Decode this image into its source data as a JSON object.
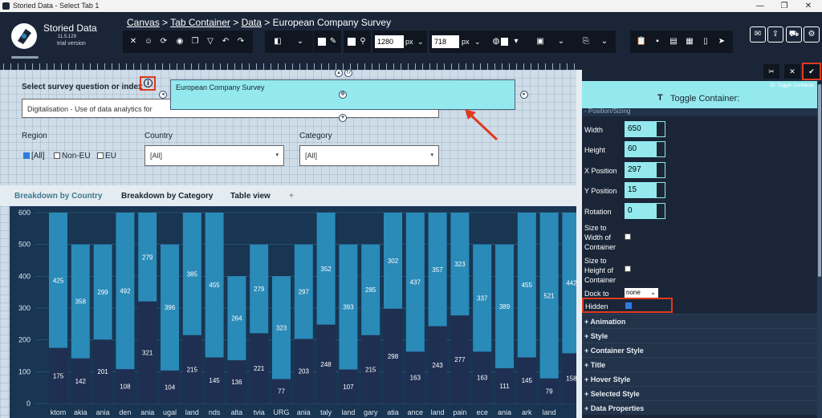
{
  "window": {
    "title": "Storied Data - Select Tab 1",
    "controls": [
      "—",
      "❐",
      "✕"
    ]
  },
  "app": {
    "name": "Storied Data",
    "version": "11.5.129",
    "edition": "trial version"
  },
  "breadcrumb": {
    "items": [
      "Canvas",
      "Tab Container",
      "Data"
    ],
    "sep": ">",
    "current": "European Company Survey"
  },
  "toolbar": {
    "width_value": "1280",
    "height_value": "718",
    "unit": "px"
  },
  "canvas": {
    "question_label": "Select survey question or index",
    "question_value": "Digitalisation - Use of data analytics for",
    "overlay_title": "European Company Survey",
    "region_label": "Region",
    "country_label": "Country",
    "category_label": "Category",
    "regions": [
      {
        "label": "[All]",
        "checked": true
      },
      {
        "label": "Non-EU",
        "checked": false
      },
      {
        "label": "EU",
        "checked": false
      }
    ],
    "country_value": "[All]",
    "category_value": "[All]",
    "tabs": [
      "Breakdown by Country",
      "Breakdown by Category",
      "Table view"
    ],
    "tab_add": "+"
  },
  "chart_data": {
    "type": "bar",
    "stacked": true,
    "ylim": [
      0,
      600
    ],
    "yticks": [
      "0",
      "100",
      "200",
      "300",
      "400",
      "500",
      "600"
    ],
    "xlabels": [
      "ktom",
      "akia",
      "ania",
      "den",
      "ania",
      "ugal",
      "land",
      "nds",
      "alta",
      "tvia",
      "URG",
      "ania",
      "taly",
      "land",
      "gary",
      "atia",
      "ance",
      "land",
      "pain",
      "ece",
      "ania",
      "ark",
      "land",
      ""
    ],
    "series": [
      {
        "values": [
          175,
          142,
          201,
          108,
          321,
          104,
          215,
          145,
          136,
          221,
          77,
          203,
          248,
          107,
          215,
          298,
          163,
          243,
          277,
          163,
          111,
          145,
          79,
          158
        ]
      },
      {
        "values": [
          425,
          358,
          299,
          492,
          279,
          396,
          385,
          455,
          264,
          279,
          323,
          297,
          352,
          393,
          285,
          302,
          437,
          357,
          323,
          337,
          389,
          455,
          521,
          442
        ]
      }
    ],
    "colors": {
      "bottom": "#1f2f52",
      "top": "#2a8ab8"
    }
  },
  "panel": {
    "id_text": "ID: Toggle Container",
    "title": "Toggle Container:",
    "section": "- Position/Sizing",
    "fields": {
      "width": {
        "label": "Width",
        "value": "650"
      },
      "height": {
        "label": "Height",
        "value": "60"
      },
      "x": {
        "label": "X Position",
        "value": "297"
      },
      "y": {
        "label": "Y Position",
        "value": "15"
      },
      "rotation": {
        "label": "Rotation",
        "value": "0"
      }
    },
    "size_w_lines": [
      "Size to",
      "Width of",
      "Container"
    ],
    "size_h_lines": [
      "Size to",
      "Height of",
      "Container"
    ],
    "dock_label": "Dock to",
    "dock_value": "none",
    "hidden_label": "Hidden",
    "sections": [
      "+ Animation",
      "+ Style",
      "+ Container Style",
      "+ Title",
      "+ Hover Style",
      "+ Selected Style",
      "+ Data Properties"
    ]
  },
  "accent": {
    "red": "#e03a1e",
    "cyan": "#93e9ee"
  }
}
